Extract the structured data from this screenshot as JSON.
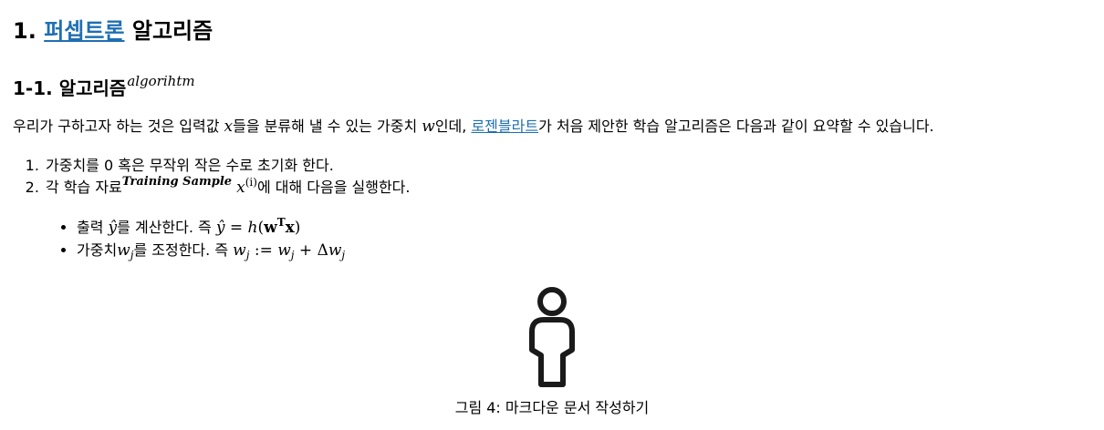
{
  "heading1": {
    "number": "1.",
    "link_text": "퍼셉트론",
    "rest": "알고리즘"
  },
  "heading2": {
    "number": "1-1.",
    "title": "알고리즘",
    "superscript": "algorihtm"
  },
  "paragraph": {
    "part1": "우리가 구하고자 하는 것은 입력값 ",
    "var_x": "x",
    "part2": "들을 분류해 낼 수 있는 가중치 ",
    "var_w": "w",
    "part3": "인데, ",
    "link_text": "로젠블라트",
    "part4": "가 처음 제안한 학습 알고리즘은 다음과 같이 요약할 수 있습니다."
  },
  "steps": {
    "item1": "가중치를 0 혹은 무작위 작은 수로 초기화 한다.",
    "item2_prefix": "각 학습 자료",
    "item2_sup": "Training Sample",
    "item2_var": "x",
    "item2_var_sup": "(i)",
    "item2_suffix": "에 대해 다음을 실행한다."
  },
  "bullets": {
    "b1_prefix": "출력 ",
    "b1_yhat": "ŷ",
    "b1_mid": "를 계산한다. 즉 ",
    "b1_yhat2": "ŷ",
    "b1_eq": " = ",
    "b1_h": "h",
    "b1_open": "(",
    "b1_w": "w",
    "b1_T": "T",
    "b1_x": "x",
    "b1_close": ")",
    "b2_prefix": "가중치",
    "b2_w": "w",
    "b2_j": "j",
    "b2_mid": "를 조정한다. 즉 ",
    "b2_w2": "w",
    "b2_j2": "j",
    "b2_assign": " := ",
    "b2_w3": "w",
    "b2_j3": "j",
    "b2_plus": " + Δ",
    "b2_w4": "w",
    "b2_j4": "j"
  },
  "figure": {
    "icon": "person-icon",
    "caption": "그림 4: 마크다운 문서 작성하기"
  },
  "colors": {
    "link": "#1f6fb2",
    "text": "#000000"
  }
}
